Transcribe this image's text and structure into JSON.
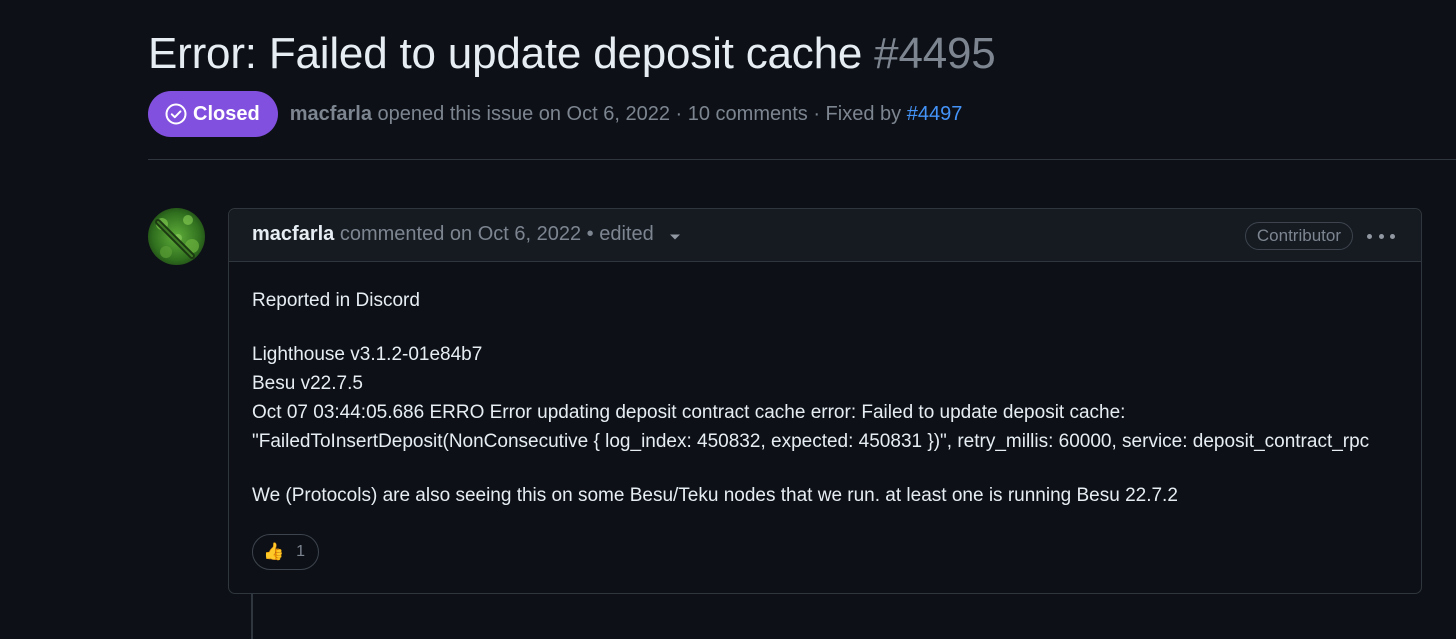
{
  "issue": {
    "title": "Error: Failed to update deposit cache",
    "number": "#4495",
    "state": "Closed",
    "author": "macfarla",
    "opened_text": "opened this issue on Oct 6, 2022 · 10 comments · Fixed by",
    "fixed_by": "#4497"
  },
  "comment": {
    "author": "macfarla",
    "meta": "commented on Oct 6, 2022 • edited",
    "role": "Contributor",
    "body": {
      "line1": "Reported in Discord",
      "block": [
        "Lighthouse v3.1.2-01e84b7",
        "Besu v22.7.5",
        "Oct 07 03:44:05.686 ERRO Error updating deposit contract cache error: Failed to update deposit cache:",
        "\"FailedToInsertDeposit(NonConsecutive { log_index: 450832, expected: 450831 })\", retry_millis: 60000, service: deposit_contract_rpc"
      ],
      "line3": "We (Protocols) are also seeing this on some Besu/Teku nodes that we run. at least one is running Besu 22.7.2"
    },
    "reactions": [
      {
        "emoji": "👍",
        "count": "1"
      }
    ]
  },
  "colors": {
    "background": "#0d1117",
    "closed_badge": "#8250df",
    "link": "#4493f8",
    "muted": "#7d8590",
    "border": "#30363d"
  },
  "icons": [
    "check-circle-icon",
    "caret-down-icon",
    "kebab-horizontal-icon",
    "thumbs-up-icon"
  ]
}
